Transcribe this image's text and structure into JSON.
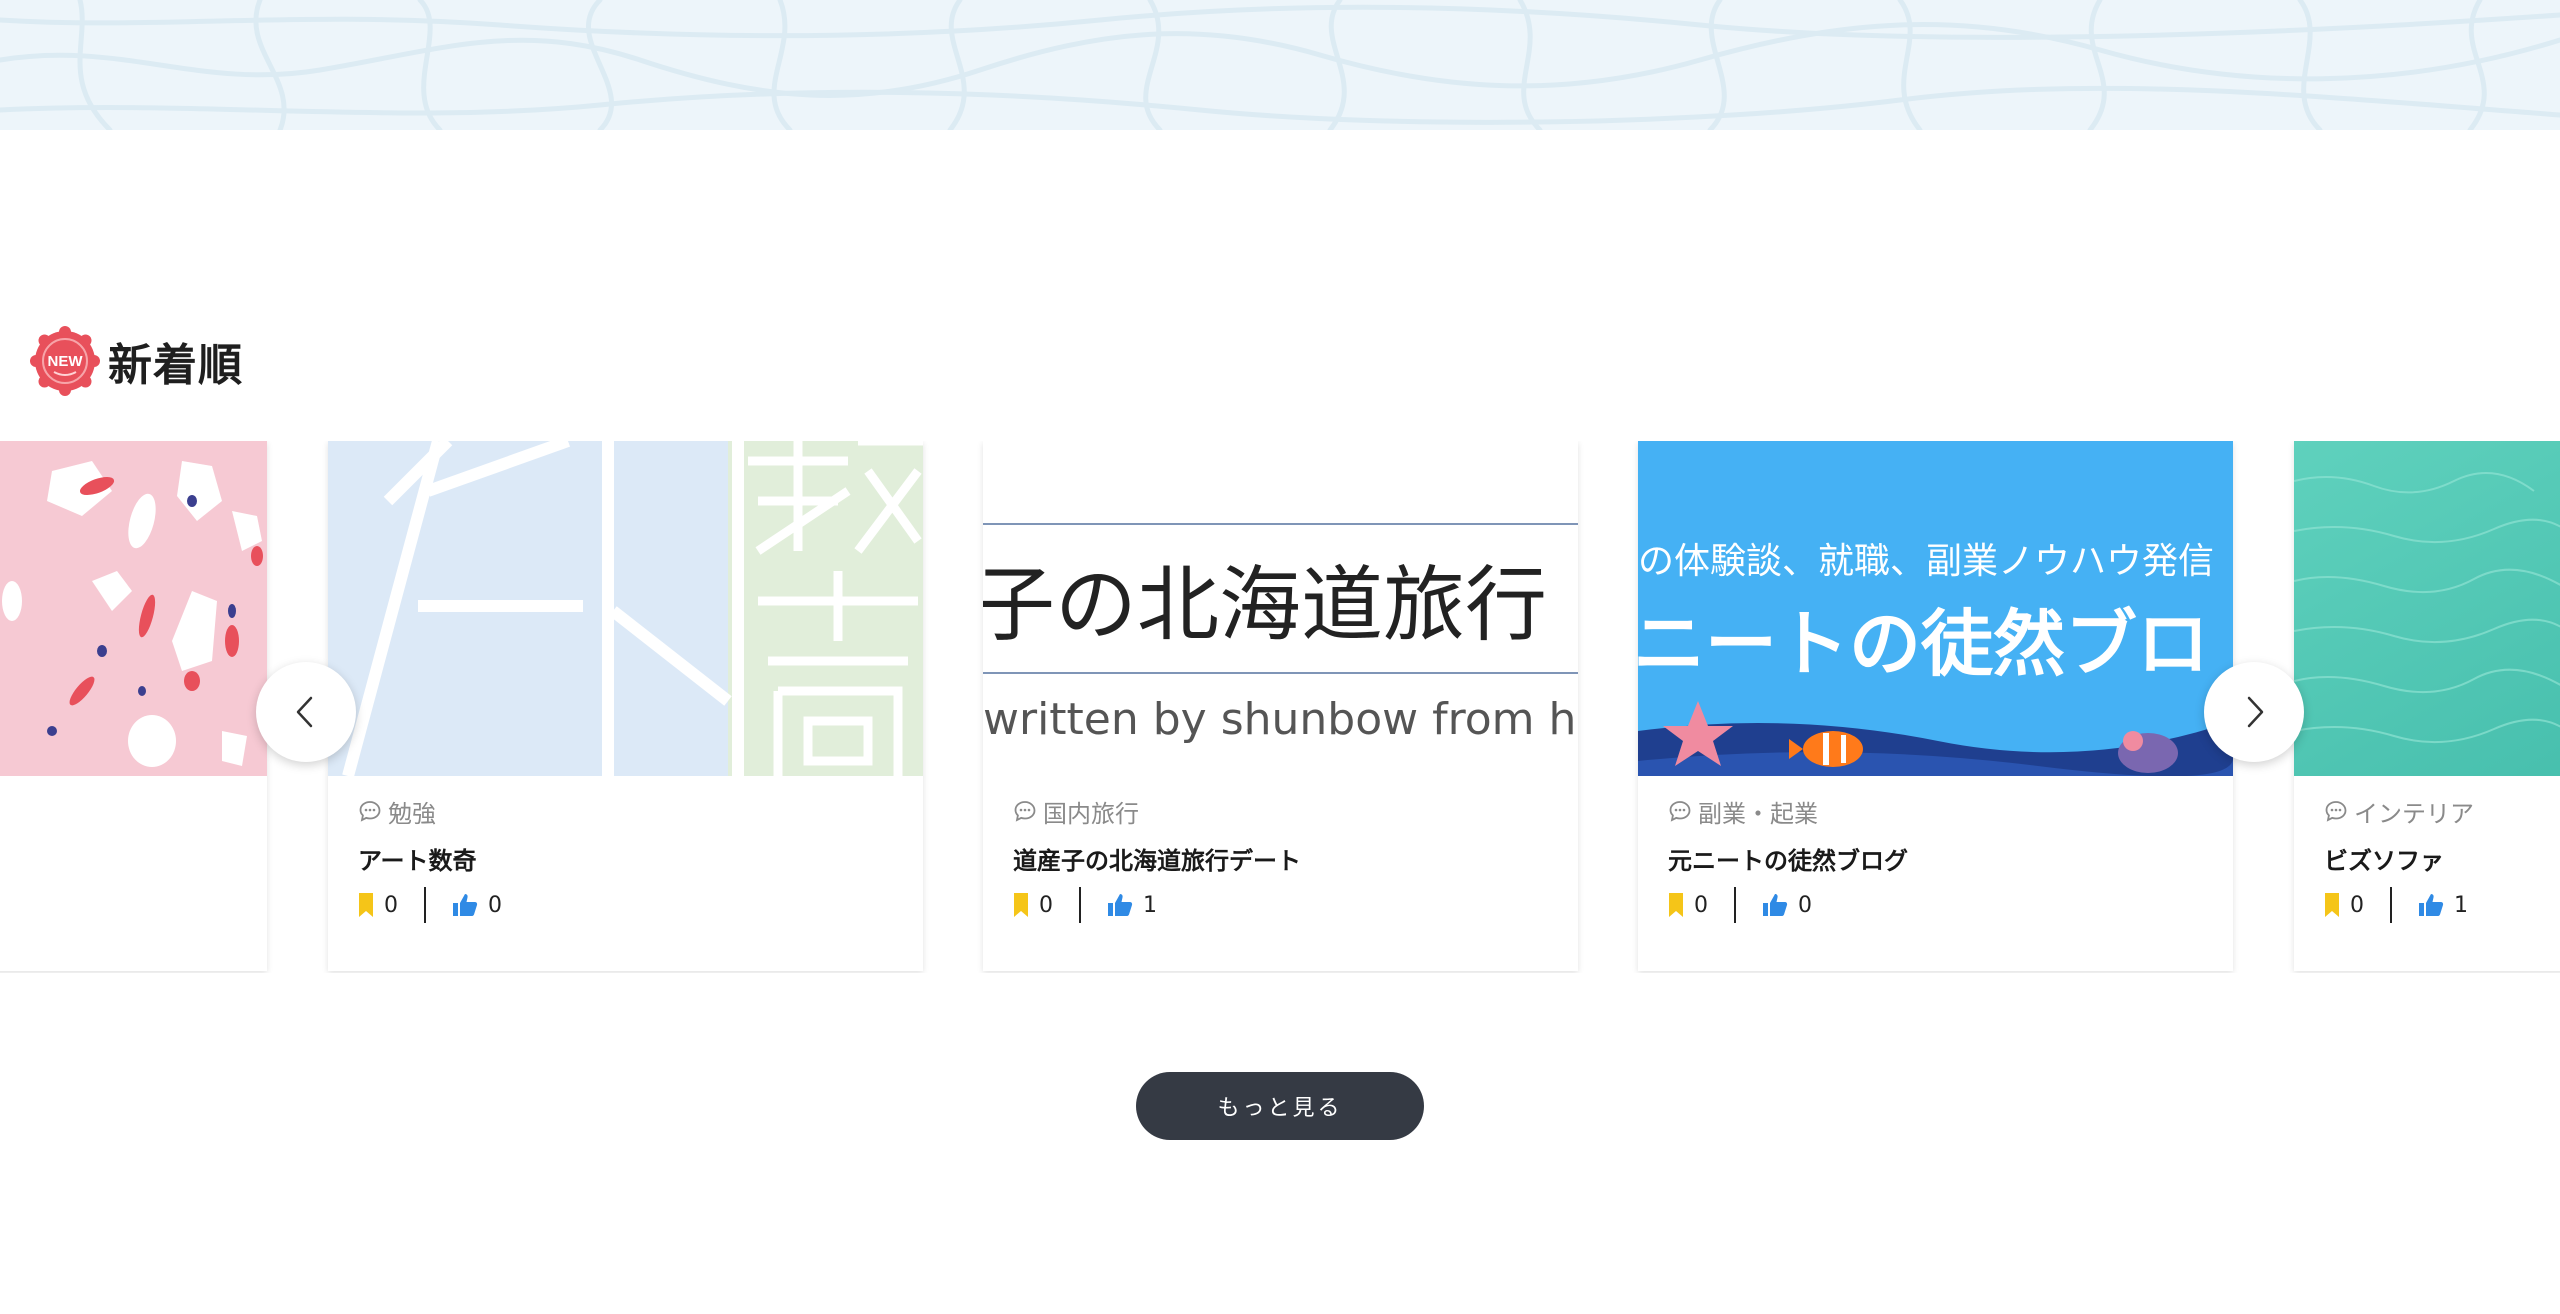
{
  "section": {
    "badge_text": "NEW",
    "title": "新着順"
  },
  "cards": [
    {
      "category": "",
      "title": "",
      "bookmarks": "",
      "likes": ""
    },
    {
      "category": "勉強",
      "title": "アート数奇",
      "bookmarks": "0",
      "likes": "0",
      "thumb_text": "数奇"
    },
    {
      "category": "国内旅行",
      "title": "道産子の北海道旅行デート",
      "bookmarks": "0",
      "likes": "1",
      "thumb_text_main": "子の北海道旅行",
      "thumb_text_sub": "written by shunbow from hok"
    },
    {
      "category": "副業・起業",
      "title": "元ニートの徒然ブログ",
      "bookmarks": "0",
      "likes": "0",
      "thumb_text_top": "の体験談、就職、副業ノウハウ発信",
      "thumb_text_main": "ニートの徒然ブロ"
    },
    {
      "category": "インテリア",
      "title": "ビズソファ",
      "bookmarks": "0",
      "likes": "1"
    }
  ],
  "more_button": {
    "label": "もっと見る"
  },
  "colors": {
    "banner_bg": "#edf5fa",
    "badge": "#e8505b",
    "bookmark": "#f5c518",
    "like": "#2f8ae5",
    "button_bg": "#353a44"
  },
  "icons": {
    "prev": "chevron-left-icon",
    "next": "chevron-right-icon",
    "category": "chat-bubble-icon",
    "bookmark": "bookmark-icon",
    "like": "thumbs-up-icon"
  }
}
